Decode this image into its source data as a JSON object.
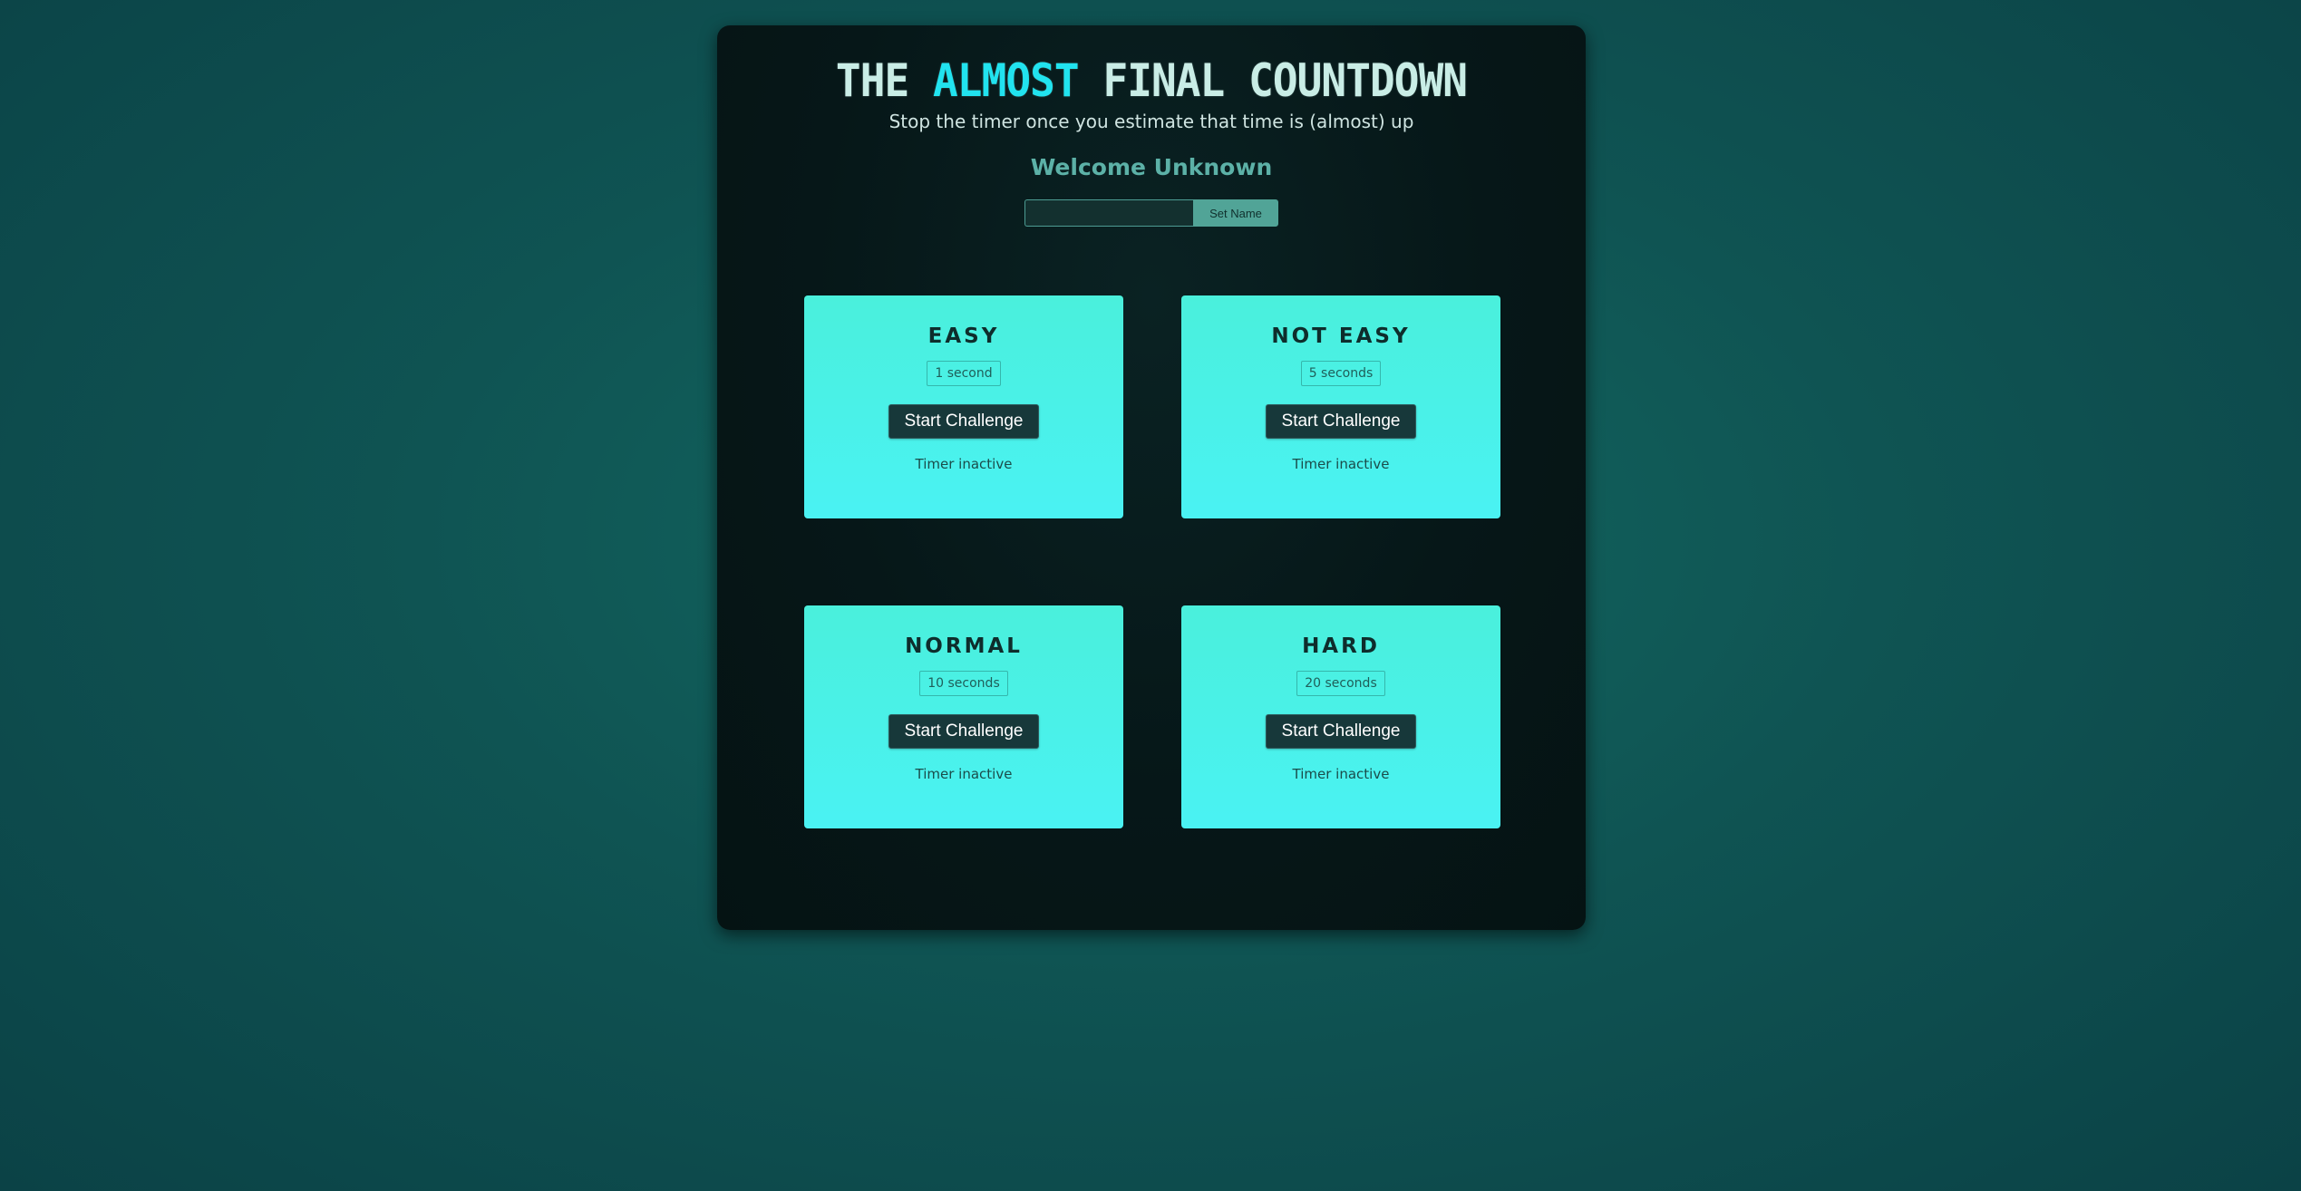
{
  "header": {
    "title_part1": "THE ",
    "title_accent": "ALMOST",
    "title_part2": " FINAL COUNTDOWN",
    "subtitle": "Stop the timer once you estimate that time is (almost) up",
    "welcome": "Welcome Unknown"
  },
  "name_form": {
    "input_value": "",
    "input_placeholder": "",
    "button_label": "Set Name"
  },
  "challenges": [
    {
      "title": "EASY",
      "duration": "1 second",
      "button_label": "Start Challenge",
      "status": "Timer inactive"
    },
    {
      "title": "NOT EASY",
      "duration": "5 seconds",
      "button_label": "Start Challenge",
      "status": "Timer inactive"
    },
    {
      "title": "NORMAL",
      "duration": "10 seconds",
      "button_label": "Start Challenge",
      "status": "Timer inactive"
    },
    {
      "title": "HARD",
      "duration": "20 seconds",
      "button_label": "Start Challenge",
      "status": "Timer inactive"
    }
  ],
  "colors": {
    "accent": "#21e3ef",
    "card_gradient_top": "#4af0dc",
    "card_gradient_bottom": "#4af2f3",
    "button_dark": "#17383a",
    "set_name_button": "#51a497"
  }
}
